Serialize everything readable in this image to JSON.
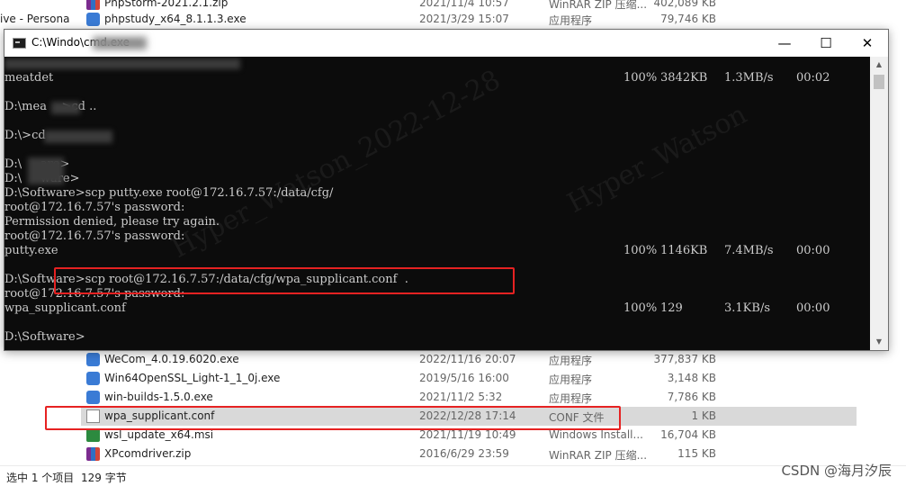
{
  "explorer": {
    "nav_partial": "ive - Persona",
    "files_top": [
      {
        "name": "PhpStorm-2021.2.1.zip",
        "date": "2021/11/4 10:57",
        "type": "WinRAR ZIP 压缩...",
        "size": "402,089 KB",
        "icon": "winrar-archive-icon"
      },
      {
        "name": "phpstudy_x64_8.1.1.3.exe",
        "date": "2021/3/29 15:07",
        "type": "应用程序",
        "size": "79,746 KB",
        "icon": "installer-exe-icon"
      }
    ],
    "files": [
      {
        "name": "WeCom_4.0.19.6020.exe",
        "date": "2022/11/16 20:07",
        "type": "应用程序",
        "size": "377,837 KB",
        "icon": "installer-exe-icon"
      },
      {
        "name": "Win64OpenSSL_Light-1_1_0j.exe",
        "date": "2019/5/16 16:00",
        "type": "应用程序",
        "size": "3,148 KB",
        "icon": "installer-exe-icon"
      },
      {
        "name": "win-builds-1.5.0.exe",
        "date": "2021/11/2 5:32",
        "type": "应用程序",
        "size": "7,786 KB",
        "icon": "installer-exe-icon"
      },
      {
        "name": "wpa_supplicant.conf",
        "date": "2022/12/28 17:14",
        "type": "CONF 文件",
        "size": "1 KB",
        "icon": "text-file-icon"
      },
      {
        "name": "wsl_update_x64.msi",
        "date": "2021/11/19 10:49",
        "type": "Windows Install...",
        "size": "16,704 KB",
        "icon": "msi-package-icon"
      },
      {
        "name": "XPcomdriver.zip",
        "date": "2016/6/29 23:59",
        "type": "WinRAR ZIP 压缩...",
        "size": "115 KB",
        "icon": "winrar-archive-icon"
      }
    ],
    "status": {
      "selected": "选中 1 个项目",
      "size": "129 字节"
    }
  },
  "console_window": {
    "title": "C:\\Windo\\cmd.exe",
    "controls": {
      "minimize": "—",
      "maximize": "☐",
      "close": "✕"
    }
  },
  "console": {
    "lines": [
      {
        "text": "",
        "stats": null
      },
      {
        "text": "meatdet",
        "stats": [
          "100%",
          "3842KB",
          "1.3MB/s",
          "00:02"
        ]
      },
      {
        "text": "",
        "stats": null
      },
      {
        "text": "D:\\mea    >cd ..",
        "stats": null
      },
      {
        "text": "",
        "stats": null
      },
      {
        "text": "D:\\>cd",
        "stats": null
      },
      {
        "text": "",
        "stats": null
      },
      {
        "text": "D:\\     are>",
        "stats": null
      },
      {
        "text": "D:\\     ware>",
        "stats": null
      },
      {
        "text": "D:\\Software>scp putty.exe root@172.16.7.57:/data/cfg/",
        "stats": null
      },
      {
        "text": "root@172.16.7.57's password:",
        "stats": null
      },
      {
        "text": "Permission denied, please try again.",
        "stats": null
      },
      {
        "text": "root@172.16.7.57's password:",
        "stats": null
      },
      {
        "text": "putty.exe",
        "stats": [
          "100%",
          "1146KB",
          "7.4MB/s",
          "00:00"
        ]
      },
      {
        "text": "",
        "stats": null
      },
      {
        "text": "D:\\Software>scp root@172.16.7.57:/data/cfg/wpa_supplicant.conf  .",
        "stats": null
      },
      {
        "text": "root@172.16.7.57's password:",
        "stats": null
      },
      {
        "text": "wpa_supplicant.conf",
        "stats": [
          "100%",
          "129",
          "3.1KB/s",
          "00:00"
        ]
      },
      {
        "text": "",
        "stats": null
      },
      {
        "text": "D:\\Software>",
        "stats": null
      }
    ]
  },
  "watermark": "CSDN @海月汐辰",
  "colors": {
    "console_bg": "#0c0c0c",
    "console_fg": "#cccccc",
    "highlight": "#e62222",
    "selected_row": "#d9d9d9"
  }
}
